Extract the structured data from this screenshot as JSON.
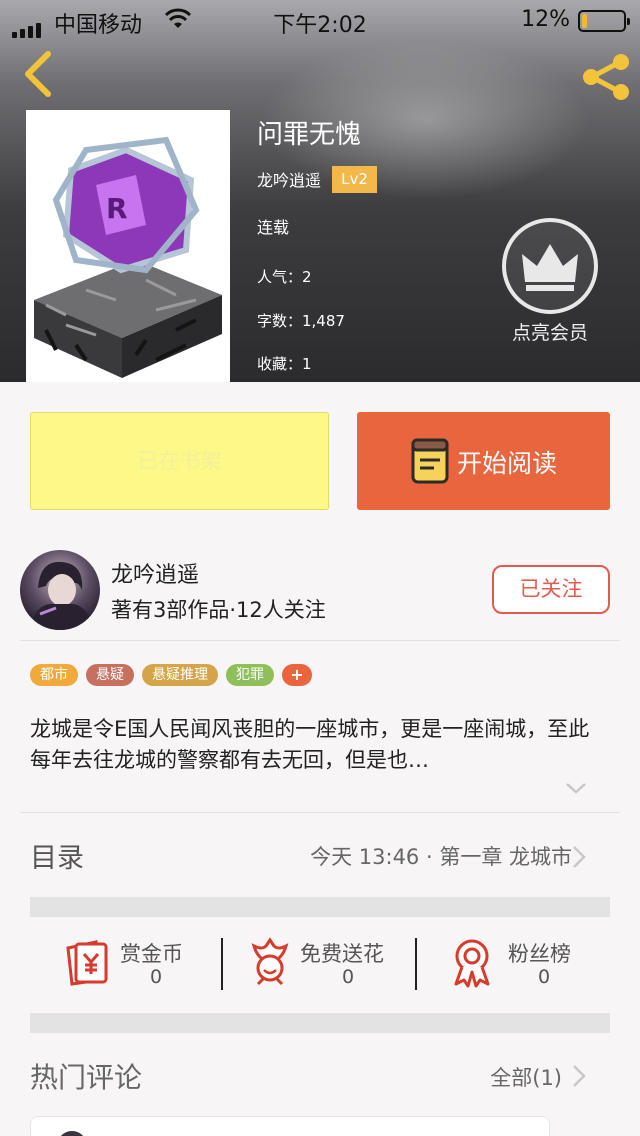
{
  "status_bar": {
    "carrier": "中国移动",
    "time": "下午2:02",
    "battery": "12%",
    "battery_level": 0.12
  },
  "book": {
    "title": "问罪无愧",
    "author": "龙吟逍遥",
    "level": "Lv2",
    "status": "连载",
    "popularity": "人气：2",
    "word_count": "字数：1,487",
    "favorites": "收藏：1"
  },
  "vip": {
    "label": "点亮会员",
    "icon": "crown-icon"
  },
  "actions": {
    "shelf_label": "已在书架",
    "read_label": "开始阅读"
  },
  "author_card": {
    "name": "龙吟逍遥",
    "meta": "著有3部作品·12人关注",
    "follow_label": "已关注"
  },
  "tags": [
    {
      "label": "都市",
      "color": "#f2a93b"
    },
    {
      "label": "悬疑",
      "color": "#c7705f"
    },
    {
      "label": "悬疑推理",
      "color": "#d4a449"
    },
    {
      "label": "犯罪",
      "color": "#8fbf5a"
    },
    {
      "label": "+",
      "color": "#e8653e"
    }
  ],
  "description": "龙城是令E国人民闻风丧胆的一座城市，更是一座闹城，至此每年去往龙城的警察都有去无回，但是也…",
  "toc": {
    "title": "目录",
    "latest": "今天 13:46 · 第一章 龙城市"
  },
  "stats": [
    {
      "label": "赏金币",
      "value": "0",
      "icon": "reward-coin-icon"
    },
    {
      "label": "免费送花",
      "value": "0",
      "icon": "flower-icon"
    },
    {
      "label": "粉丝榜",
      "value": "0",
      "icon": "fan-ranking-medal-icon"
    }
  ],
  "comments": {
    "title": "热门评论",
    "all_label": "全部(1)"
  },
  "colors": {
    "accent": "#e8653e",
    "shelf_bg": "#fdf888",
    "follow": "#e35b4f",
    "header_bg": "#2b2b2e"
  }
}
